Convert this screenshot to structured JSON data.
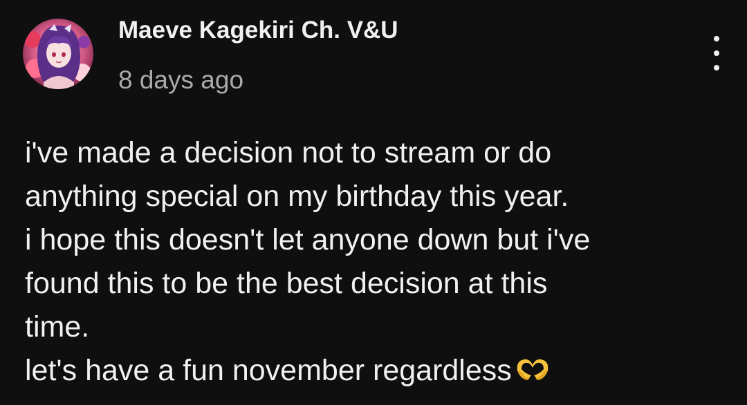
{
  "post": {
    "author": {
      "name": "Maeve Kagekiri Ch. V&U",
      "avatar_icon": "channel-avatar"
    },
    "timestamp": "8 days ago",
    "menu_icon": "more-vertical-icon",
    "body_lines": [
      "i've made a decision not to stream or do",
      "anything special on my birthday this year.",
      "i hope this doesn't let anyone down but i've",
      "found this to be the best decision at this",
      "time.",
      "let's have a fun november regardless"
    ],
    "emoji": "heart-hands-icon"
  },
  "colors": {
    "background": "#0f0f0f",
    "text_primary": "#f1f1f1",
    "text_secondary": "#aaaaaa",
    "emoji_yellow": "#f7c23b"
  }
}
